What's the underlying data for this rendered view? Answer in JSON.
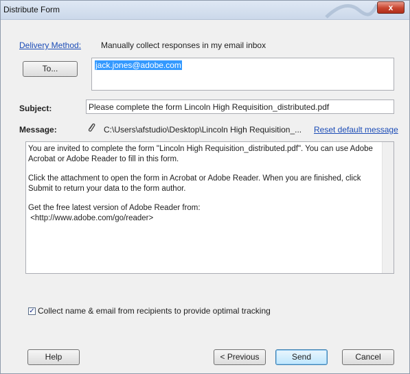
{
  "window": {
    "title": "Distribute Form",
    "close_label": "x"
  },
  "delivery": {
    "link_label": "Delivery Method:",
    "value": "Manually collect responses in my email inbox"
  },
  "to": {
    "button_label": "To...",
    "recipients": "jack.jones@adobe.com"
  },
  "subject": {
    "label": "Subject:",
    "value": "Please complete the form Lincoln High Requisition_distributed.pdf"
  },
  "message": {
    "label": "Message:",
    "attachment_icon": "paperclip-icon",
    "attachment_path": "C:\\Users\\afstudio\\Desktop\\Lincoln High Requisition_...",
    "reset_label": "Reset default message",
    "paragraphs": [
      "You are invited to complete the form \"Lincoln High Requisition_distributed.pdf\". You can use Adobe Acrobat or Adobe Reader to fill in this form.",
      "Click the attachment to open the form in Acrobat or Adobe Reader. When you are finished, click Submit to return your data to the form author.",
      "Get the free latest version of Adobe Reader from:",
      " <http://www.adobe.com/go/reader>"
    ]
  },
  "collect": {
    "checked": true,
    "label": "Collect name & email from recipients to provide optimal tracking"
  },
  "buttons": {
    "help": "Help",
    "previous": "< Previous",
    "send": "Send",
    "cancel": "Cancel"
  },
  "colors": {
    "link": "#1a4bb6",
    "selection": "#3399ff",
    "close_button": "#c8452f"
  }
}
